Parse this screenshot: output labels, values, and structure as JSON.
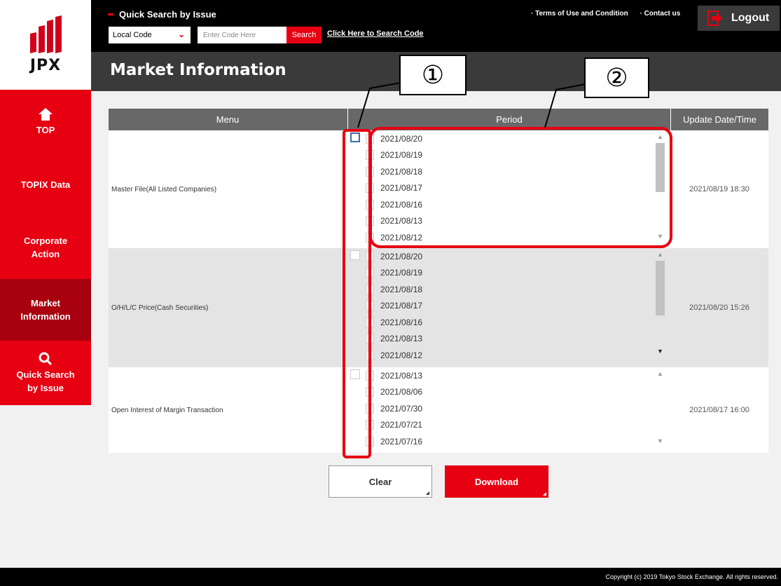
{
  "brand": {
    "logo_text": "JPX"
  },
  "sidebar": {
    "items": [
      {
        "label": "TOP",
        "icon": "home-icon"
      },
      {
        "label": "TOPIX Data"
      },
      {
        "label": "Corporate Action"
      },
      {
        "label": "Market Information",
        "active": true
      },
      {
        "label": "Quick Search by Issue",
        "icon": "search-icon"
      }
    ]
  },
  "header": {
    "quick_search_title": "Quick Search by Issue",
    "code_type": "Local Code",
    "code_placeholder": "Enter Code Here",
    "search_button": "Search",
    "search_code_link": "Click Here to Search Code",
    "terms_link": "· Terms of Use and Condition",
    "contact_link": "· Contact us",
    "logout": "Logout"
  },
  "page_title": "Market Information",
  "table": {
    "headers": {
      "menu": "Menu",
      "period": "Period",
      "update": "Update Date/Time"
    },
    "rows": [
      {
        "menu": "Master File(All Listed Companies)",
        "periods": [
          "2021/08/20",
          "2021/08/19",
          "2021/08/18",
          "2021/08/17",
          "2021/08/16",
          "2021/08/13",
          "2021/08/12"
        ],
        "update": "2021/08/19 18:30"
      },
      {
        "menu": "O/H/L/C Price(Cash Securities)",
        "periods": [
          "2021/08/20",
          "2021/08/19",
          "2021/08/18",
          "2021/08/17",
          "2021/08/16",
          "2021/08/13",
          "2021/08/12"
        ],
        "update": "2021/08/20 15:26"
      },
      {
        "menu": "Open Interest of Margin Transaction",
        "periods": [
          "2021/08/13",
          "2021/08/06",
          "2021/07/30",
          "2021/07/21",
          "2021/07/16"
        ],
        "update": "2021/08/17 16:00"
      }
    ]
  },
  "buttons": {
    "clear": "Clear",
    "download": "Download"
  },
  "callouts": {
    "one": "①",
    "two": "②"
  },
  "footer": {
    "copyright": "Copyright (c) 2019 Tokyo Stock Exchange. All rights reserved."
  },
  "colors": {
    "brand_red": "#e60012",
    "active_nav": "#a8000f",
    "header_dark": "#3a3a3a",
    "table_head": "#686868"
  }
}
